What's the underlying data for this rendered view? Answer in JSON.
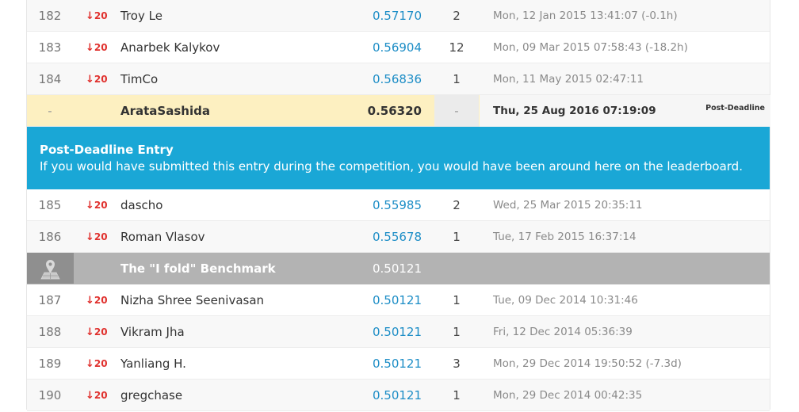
{
  "rows_before": [
    {
      "rank": "182",
      "delta": "20",
      "name": "Troy Le",
      "score": "0.57170",
      "entries": "2",
      "last": "Mon, 12 Jan 2015 13:41:07 (-0.1h)"
    },
    {
      "rank": "183",
      "delta": "20",
      "name": "Anarbek Kalykov",
      "score": "0.56904",
      "entries": "12",
      "last": "Mon, 09 Mar 2015 07:58:43 (-18.2h)"
    },
    {
      "rank": "184",
      "delta": "20",
      "name": "TimCo",
      "score": "0.56836",
      "entries": "1",
      "last": "Mon, 11 May 2015 02:47:11"
    }
  ],
  "post_deadline_row": {
    "rank": "-",
    "name": "ArataSashida",
    "score": "0.56320",
    "entries": "-",
    "last": "Thu, 25 Aug 2016 07:19:09",
    "badge": "Post-Deadline"
  },
  "banner": {
    "title": "Post-Deadline Entry",
    "text": "If you would have submitted this entry during the competition, you would have been around here on the leaderboard."
  },
  "rows_middle": [
    {
      "rank": "185",
      "delta": "20",
      "name": "dascho",
      "score": "0.55985",
      "entries": "2",
      "last": "Wed, 25 Mar 2015 20:35:11"
    },
    {
      "rank": "186",
      "delta": "20",
      "name": "Roman Vlasov",
      "score": "0.55678",
      "entries": "1",
      "last": "Tue, 17 Feb 2015 16:37:14"
    }
  ],
  "benchmark_row": {
    "icon": "map-pin-icon",
    "name": "The \"I fold\" Benchmark",
    "score": "0.50121"
  },
  "rows_after": [
    {
      "rank": "187",
      "delta": "20",
      "name": "Nizha Shree Seenivasan",
      "score": "0.50121",
      "entries": "1",
      "last": "Tue, 09 Dec 2014 10:31:46"
    },
    {
      "rank": "188",
      "delta": "20",
      "name": "Vikram Jha",
      "score": "0.50121",
      "entries": "1",
      "last": "Fri, 12 Dec 2014 05:36:39"
    },
    {
      "rank": "189",
      "delta": "20",
      "name": "Yanliang H.",
      "score": "0.50121",
      "entries": "3",
      "last": "Mon, 29 Dec 2014 19:50:52 (-7.3d)"
    },
    {
      "rank": "190",
      "delta": "20",
      "name": "gregchase",
      "score": "0.50121",
      "entries": "1",
      "last": "Mon, 29 Dec 2014 00:42:35"
    }
  ],
  "colors": {
    "score_link": "#1c8dc6",
    "delta_down": "#e0312e",
    "post_deadline_bg": "#fdf0c1",
    "banner_bg": "#1aa7d6",
    "benchmark_bg": "#b3b3b3"
  },
  "icons": {
    "delta": "down-arrow-icon",
    "benchmark": "map-pin-icon"
  }
}
